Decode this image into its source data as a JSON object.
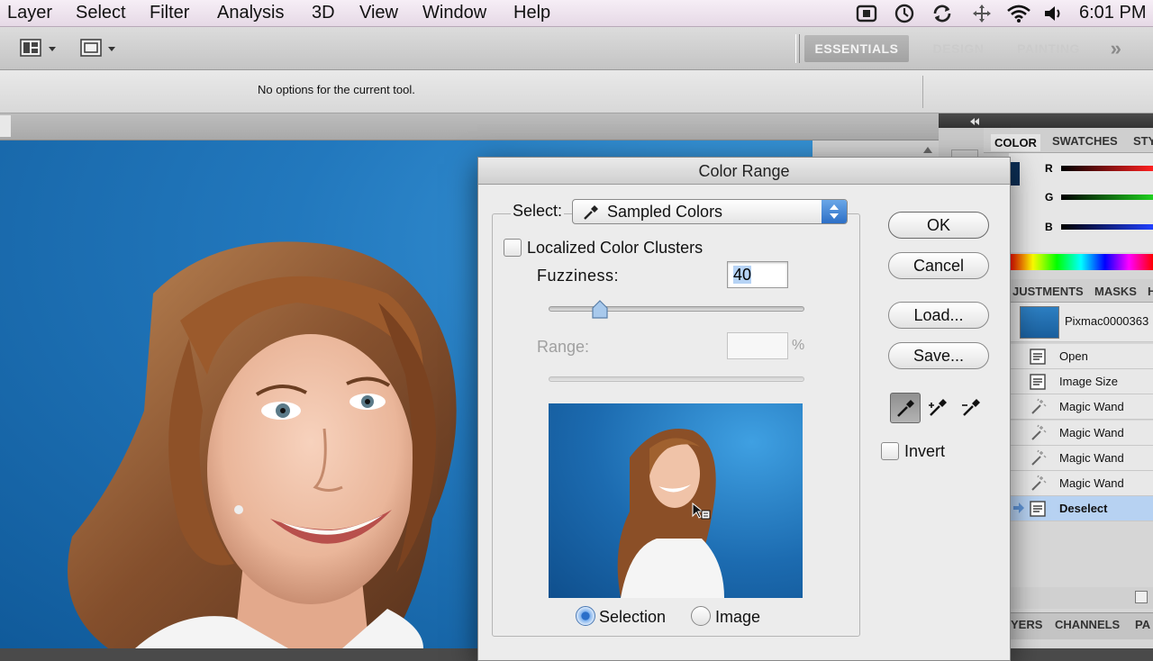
{
  "menubar": {
    "items": [
      "Layer",
      "Select",
      "Filter",
      "Analysis",
      "3D",
      "View",
      "Window",
      "Help"
    ],
    "clock": "6:01 PM"
  },
  "appbar": {
    "workspaces": [
      "ESSENTIALS",
      "DESIGN",
      "PAINTING"
    ],
    "more": "»"
  },
  "options_bar": {
    "message": "No options for the current tool."
  },
  "panels": {
    "color_tabs": [
      "COLOR",
      "SWATCHES",
      "STY"
    ],
    "channels": [
      "R",
      "G",
      "B"
    ],
    "adj_tabs": [
      "JUSTMENTS",
      "MASKS",
      "H"
    ],
    "snapshot_name": "Pixmac0000363",
    "history": [
      {
        "label": "Open",
        "icon": "document-icon"
      },
      {
        "label": "Image Size",
        "icon": "list-icon"
      },
      {
        "label": "Magic Wand",
        "icon": "magic-wand-icon"
      },
      {
        "label": "Magic Wand",
        "icon": "magic-wand-icon"
      },
      {
        "label": "Magic Wand",
        "icon": "magic-wand-icon"
      },
      {
        "label": "Magic Wand",
        "icon": "magic-wand-icon"
      },
      {
        "label": "Deselect",
        "icon": "document-icon"
      }
    ],
    "history_selected_index": 6,
    "bottom_tabs": [
      "YERS",
      "CHANNELS",
      "PA"
    ]
  },
  "dialog": {
    "title": "Color Range",
    "select_label": "Select:",
    "select_value": "Sampled Colors",
    "localized_label": "Localized Color Clusters",
    "localized_checked": false,
    "fuzziness_label": "Fuzziness:",
    "fuzziness_value": "40",
    "fuzziness_fraction": 0.2,
    "range_label": "Range:",
    "range_value": "",
    "range_unit": "%",
    "buttons": {
      "ok": "OK",
      "cancel": "Cancel",
      "load": "Load...",
      "save": "Save..."
    },
    "invert_label": "Invert",
    "invert_checked": false,
    "radio_selection": "Selection",
    "radio_image": "Image",
    "radio_selected": "Selection"
  },
  "colors": {
    "canvas_blue": "#2278bd",
    "selected_row": "#b7d2f2",
    "dialog_bg": "#ececec"
  }
}
